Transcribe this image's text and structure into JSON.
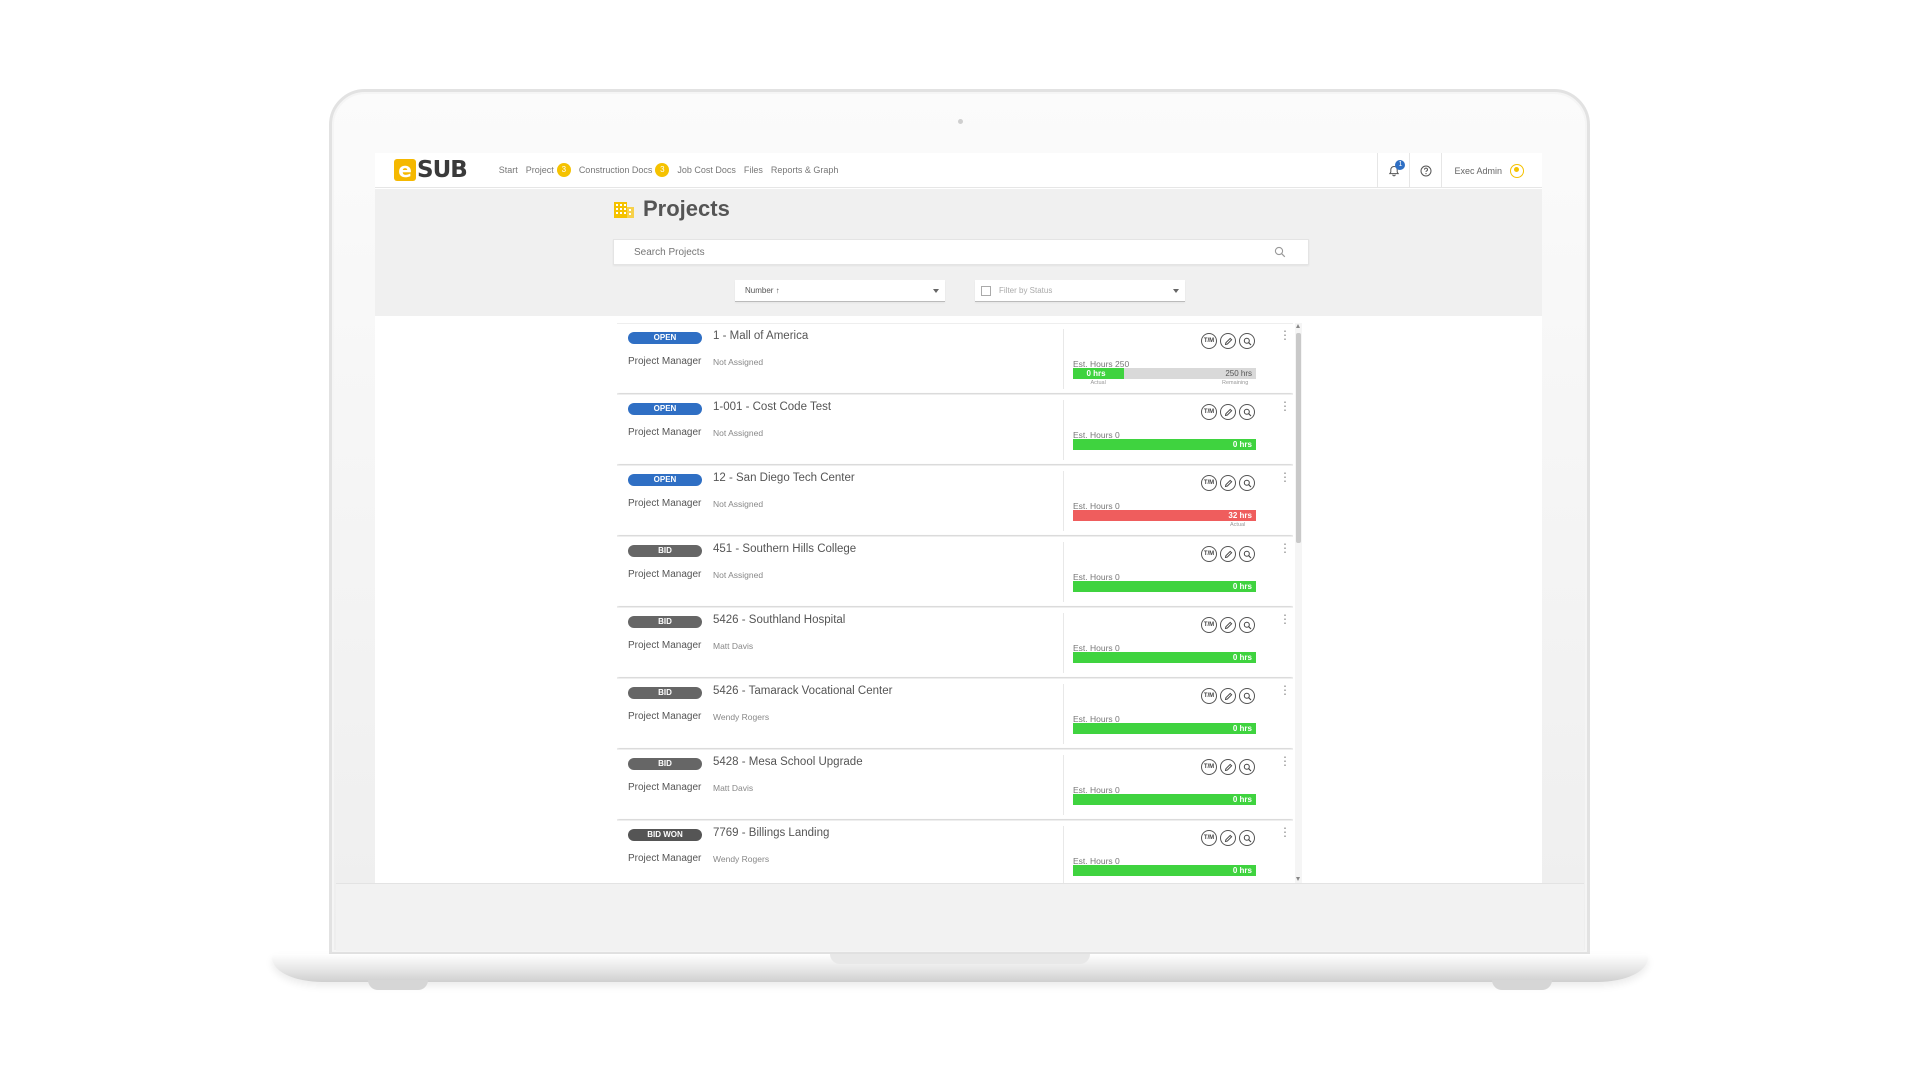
{
  "app": {
    "logo_e": "e",
    "logo_sub": "SUB"
  },
  "nav": [
    {
      "label": "Start",
      "badge": ""
    },
    {
      "label": "Project",
      "badge": "3"
    },
    {
      "label": "Construction Docs",
      "badge": "3"
    },
    {
      "label": "Job Cost Docs",
      "badge": ""
    },
    {
      "label": "Files",
      "badge": ""
    },
    {
      "label": "Reports & Graph",
      "badge": ""
    }
  ],
  "topbar": {
    "notification_count": "1",
    "user_name": "Exec Admin"
  },
  "page": {
    "title": "Projects",
    "search_placeholder": "Search Projects",
    "sort_label": "Number ↑",
    "status_filter_placeholder": "Filter by Status"
  },
  "colors": {
    "accent": "#f5b800",
    "open": "#2f6fc4",
    "bid": "#666666",
    "green": "#3fd33f",
    "red": "#ef5d5d"
  },
  "projects": [
    {
      "status": "OPEN",
      "status_color": "#2f6fc4",
      "title": "1 - Mall of America",
      "pm_label": "Project Manager",
      "pm": "Not Assigned",
      "est_label": "Est. Hours 250",
      "bar_color": "#3fd33f",
      "bar_fraction": 0.28,
      "bar_text": "0 hrs",
      "remaining_text": "250 hrs",
      "actual_label": "Actual",
      "remaining_label": "Remaining"
    },
    {
      "status": "OPEN",
      "status_color": "#2f6fc4",
      "title": "1-001 - Cost Code Test",
      "pm_label": "Project Manager",
      "pm": "Not Assigned",
      "est_label": "Est. Hours 0",
      "bar_color": "#3fd33f",
      "bar_fraction": 1,
      "bar_text": "0 hrs",
      "remaining_text": "",
      "actual_label": "",
      "remaining_label": ""
    },
    {
      "status": "OPEN",
      "status_color": "#2f6fc4",
      "title": "12 - San Diego Tech Center",
      "pm_label": "Project Manager",
      "pm": "Not Assigned",
      "est_label": "Est. Hours 0",
      "bar_color": "#ef5d5d",
      "bar_fraction": 1,
      "bar_text": "32 hrs",
      "remaining_text": "",
      "actual_label": "Actual",
      "remaining_label": ""
    },
    {
      "status": "BID",
      "status_color": "#666666",
      "title": "451 - Southern Hills College",
      "pm_label": "Project Manager",
      "pm": "Not Assigned",
      "est_label": "Est. Hours 0",
      "bar_color": "#3fd33f",
      "bar_fraction": 1,
      "bar_text": "0 hrs",
      "remaining_text": "",
      "actual_label": "",
      "remaining_label": ""
    },
    {
      "status": "BID",
      "status_color": "#666666",
      "title": "5426 - Southland Hospital",
      "pm_label": "Project Manager",
      "pm": "Matt Davis",
      "est_label": "Est. Hours 0",
      "bar_color": "#3fd33f",
      "bar_fraction": 1,
      "bar_text": "0 hrs",
      "remaining_text": "",
      "actual_label": "",
      "remaining_label": ""
    },
    {
      "status": "BID",
      "status_color": "#666666",
      "title": "5426 - Tamarack Vocational Center",
      "pm_label": "Project Manager",
      "pm": "Wendy Rogers",
      "est_label": "Est. Hours 0",
      "bar_color": "#3fd33f",
      "bar_fraction": 1,
      "bar_text": "0 hrs",
      "remaining_text": "",
      "actual_label": "",
      "remaining_label": ""
    },
    {
      "status": "BID",
      "status_color": "#666666",
      "title": "5428 - Mesa School Upgrade",
      "pm_label": "Project Manager",
      "pm": "Matt Davis",
      "est_label": "Est. Hours 0",
      "bar_color": "#3fd33f",
      "bar_fraction": 1,
      "bar_text": "0 hrs",
      "remaining_text": "",
      "actual_label": "",
      "remaining_label": ""
    },
    {
      "status": "BID WON",
      "status_color": "#555555",
      "title": "7769 - Billings Landing",
      "pm_label": "Project Manager",
      "pm": "Wendy Rogers",
      "est_label": "Est. Hours 0",
      "bar_color": "#3fd33f",
      "bar_fraction": 1,
      "bar_text": "0 hrs",
      "remaining_text": "",
      "actual_label": "",
      "remaining_label": ""
    }
  ],
  "action_icons": [
    "tm-icon",
    "edit-icon",
    "view-icon"
  ],
  "action_tm_label": "T/M"
}
